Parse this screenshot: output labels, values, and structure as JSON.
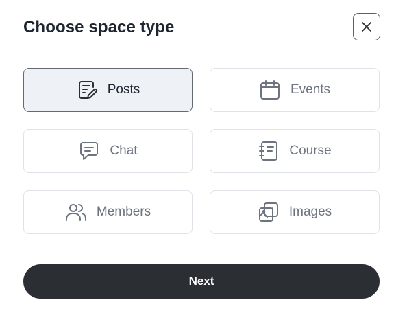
{
  "modal": {
    "title": "Choose space type"
  },
  "options": [
    {
      "label": "Posts",
      "icon": "posts-icon",
      "selected": true
    },
    {
      "label": "Events",
      "icon": "calendar-icon",
      "selected": false
    },
    {
      "label": "Chat",
      "icon": "chat-icon",
      "selected": false
    },
    {
      "label": "Course",
      "icon": "course-icon",
      "selected": false
    },
    {
      "label": "Members",
      "icon": "members-icon",
      "selected": false
    },
    {
      "label": "Images",
      "icon": "images-icon",
      "selected": false
    }
  ],
  "actions": {
    "next_label": "Next"
  },
  "colors": {
    "primary_button": "#2b2e33",
    "selected_bg": "#eef2f6",
    "selected_border": "#646a73",
    "title_text": "#1d2531",
    "muted_text": "#6d7480"
  }
}
